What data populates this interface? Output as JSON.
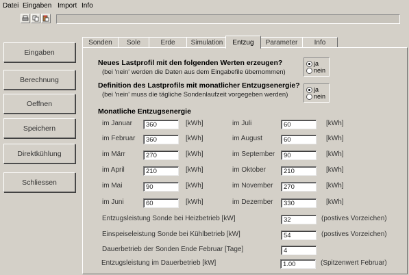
{
  "menu": [
    "Datei",
    "Eingaben",
    "Import",
    "Info"
  ],
  "toolbar": {
    "icons": [
      "print-icon",
      "copy-icon",
      "paste-icon"
    ]
  },
  "sidebar": [
    "Eingaben",
    "Berechnung",
    "Oeffnen",
    "Speichern",
    "Direktkühlung",
    "Schliessen"
  ],
  "tabs": [
    "Sonden",
    "Sole",
    "Erde",
    "Simulation",
    "Entzug",
    "Parameter",
    "Info"
  ],
  "active_tab": "Entzug",
  "q1": {
    "title": "Neues Lastprofil mit den folgenden Werten erzeugen?",
    "note": "(bei 'nein' werden die Daten aus dem Eingabefile übernommen)",
    "yes": "ja",
    "no": "nein",
    "selected": "ja"
  },
  "q2": {
    "title": "Definition des Lastprofils mit monatlicher Entzugsenergie?",
    "note": "(bei 'nein' muss die tägliche Sondenlaufzeit vorgegeben werden)",
    "yes": "ja",
    "no": "nein",
    "selected": "ja"
  },
  "monthly": {
    "title": "Monatliche Entzugsenergie",
    "unit_left": "[kWh]",
    "unit_right": "[kWh]",
    "left": [
      {
        "label": "im Januar",
        "value": "360"
      },
      {
        "label": "im Februar",
        "value": "360"
      },
      {
        "label": "im Märr",
        "value": "270"
      },
      {
        "label": "im April",
        "value": "210"
      },
      {
        "label": "im Mai",
        "value": "90"
      },
      {
        "label": "im Juni",
        "value": "60"
      }
    ],
    "right": [
      {
        "label": "im Juli",
        "value": "60"
      },
      {
        "label": "im August",
        "value": "60"
      },
      {
        "label": "im September",
        "value": "90"
      },
      {
        "label": "im Oktober",
        "value": "210"
      },
      {
        "label": "im November",
        "value": "270"
      },
      {
        "label": "im Dezember",
        "value": "330"
      }
    ]
  },
  "params": [
    {
      "label": "Entzugsleistung Sonde bei Heizbetrieb [kW]",
      "value": "32",
      "note": "(postives Vorzeichen)"
    },
    {
      "label": "Einspeiseleistung Sonde bei Kühlbetrieb [kW]",
      "value": "54",
      "note": "(postives Vorzeichen)"
    },
    {
      "label": "Dauerbetrieb der Sonden Ende Februar [Tage]",
      "value": "4",
      "note": ""
    },
    {
      "label": "Entzugsleistung im Dauerbetrieb [kW]",
      "value": "1.00",
      "note": "(Spitzenwert Februar)"
    }
  ]
}
